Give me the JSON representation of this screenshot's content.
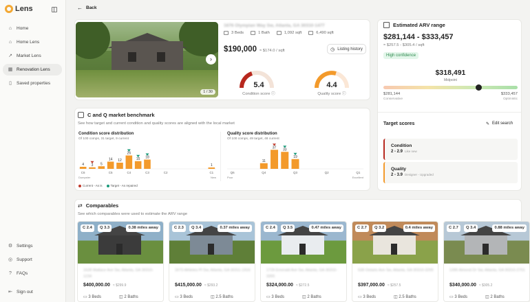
{
  "app": {
    "name": "Lens"
  },
  "nav": [
    {
      "label": "Home",
      "icon": "home-icon",
      "glyph": "⌂"
    },
    {
      "label": "Home Lens",
      "icon": "house-icon",
      "glyph": "⌂"
    },
    {
      "label": "Market Lens",
      "icon": "trend-icon",
      "glyph": "↗"
    },
    {
      "label": "Renovation Lens",
      "icon": "wrench-icon",
      "glyph": "▦"
    },
    {
      "label": "Saved properties",
      "icon": "bookmark-icon",
      "glyph": "▯"
    }
  ],
  "nav_bottom": [
    {
      "label": "Settings",
      "icon": "gear-icon",
      "glyph": "⚙"
    },
    {
      "label": "Support",
      "icon": "support-icon",
      "glyph": "◎"
    },
    {
      "label": "FAQs",
      "icon": "faq-icon",
      "glyph": "?"
    },
    {
      "label": "Sign out",
      "icon": "logout-icon",
      "glyph": "⇤"
    }
  ],
  "header": {
    "back_label": "Back"
  },
  "property": {
    "address": "1676 Olympian Way Sw, Atlanta, GA 30310-1477",
    "beds": "3 Beds",
    "baths": "1 Bath",
    "sqft": "1,092 sqft",
    "lot": "6,490 sqft",
    "price": "$190,000",
    "price_per_sqft": "≈ $174.0 / sqft",
    "photo_counter": "1 / 30",
    "listing_history": "Listing history",
    "condition_score": "5.4",
    "condition_label": "Condition score",
    "quality_score": "4.4",
    "quality_label": "Quality score"
  },
  "arv": {
    "title": "Estimated ARV range",
    "range": "$281,144 - $333,457",
    "per_sqft": "≈ $257.5 - $305.4 / sqft",
    "confidence": "High confidence",
    "midpoint": "$318,491",
    "midpoint_label": "Midpoint",
    "low": "$281,144",
    "low_label": "Conservative",
    "high": "$333,457",
    "high_label": "Optimistic",
    "midpoint_position": 0.71
  },
  "target": {
    "title": "Target scores",
    "edit": "Edit search",
    "items": [
      {
        "name": "Condition",
        "range": "2 - 2.9",
        "note": "Like new"
      },
      {
        "name": "Quality",
        "range": "2 - 3.9",
        "note": "Designer - Upgraded"
      }
    ]
  },
  "benchmark": {
    "title": "C and Q market benchmark",
    "subtitle": "See how target and current condition and quality scores are aligned with the local market",
    "legend_current": "Current - As is",
    "legend_target": "Target - As repaired",
    "colors": {
      "bar": "#f39a2b",
      "current": "#c0392b",
      "target": "#1a9a7a"
    }
  },
  "chart_data": [
    {
      "type": "bar",
      "title": "Condition score distribution",
      "subtitle": "Of 100 comps, 31 target, 9 current",
      "categories": [
        "C6",
        "",
        "",
        "C5",
        "",
        "C4",
        "",
        "C3",
        "",
        "C2",
        "",
        "",
        "",
        "",
        "C1"
      ],
      "values": [
        4,
        3,
        5,
        14,
        12,
        26,
        15,
        18,
        0,
        0,
        0,
        0,
        0,
        0,
        1
      ],
      "left_label": "Dumpster",
      "right_label": "New",
      "current_index": 1,
      "target_indices": [
        5,
        6,
        7
      ]
    },
    {
      "type": "bar",
      "title": "Quality score distribution",
      "subtitle": "Of 100 comps, 49 target, 48 current",
      "categories": [
        "Q6",
        "",
        "",
        "Q4",
        "",
        "",
        "Q3",
        "",
        "",
        "Q2",
        "",
        "",
        "Q1"
      ],
      "values": [
        0,
        0,
        0,
        11,
        37,
        33,
        19,
        0,
        0,
        0,
        0,
        0,
        0
      ],
      "left_label": "Poor",
      "right_label": "Excellent",
      "current_index": 4,
      "target_indices": [
        5,
        6
      ]
    }
  ],
  "comparables": {
    "title": "Comparables",
    "subtitle": "See which comparables were used to estimate the ARV range",
    "items": [
      {
        "c": "C 2.4",
        "q": "Q 3.3",
        "dist": "0.38 miles away",
        "addr": "1628 Wallace Ave Sw, Atlanta, GA 30310-1234",
        "price": "$400,000.00",
        "ppsf": "≈ $299.9",
        "beds": "3 Beds",
        "baths": "2 Baths"
      },
      {
        "c": "C 2.3",
        "q": "Q 3.4",
        "dist": "0.37 miles away",
        "addr": "1673 Athletes Pl Sw, Atlanta, GA 30311-1916",
        "price": "$415,000.00",
        "ppsf": "≈ $293.2",
        "beds": "3 Beds",
        "baths": "2.5 Baths"
      },
      {
        "c": "C 2.4",
        "q": "Q 3.5",
        "dist": "0.47 miles away",
        "addr": "1729 Emerald Ave Sw, Atlanta, GA 30310-3355",
        "price": "$324,000.00",
        "ppsf": "≈ $272.5",
        "beds": "3 Beds",
        "baths": "2 Baths"
      },
      {
        "c": "C 2.7",
        "q": "Q 3.2",
        "dist": "0.4 miles away",
        "addr": "538 Ontario Ave Sw, Atlanta, GA 30310-3205",
        "price": "$397,000.00",
        "ppsf": "≈ $257.5",
        "beds": "3 Beds",
        "baths": "2.5 Baths"
      },
      {
        "c": "C 2.7",
        "q": "Q 3.4",
        "dist": "0.88 miles away",
        "addr": "1395 Almond Dr Sw, Atlanta, GA 30310-2701",
        "price": "$340,000.00",
        "ppsf": "≈ $305.2",
        "beds": "3 Beds",
        "baths": "2 Baths"
      }
    ]
  }
}
